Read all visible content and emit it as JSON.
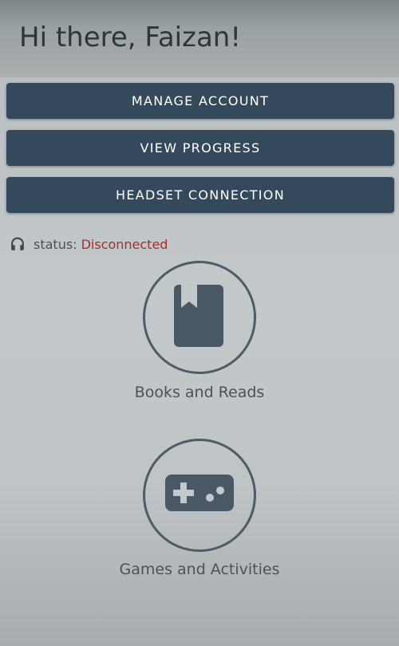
{
  "header": {
    "greeting": "Hi there, Faizan!"
  },
  "buttons": {
    "manage_account": "MANAGE ACCOUNT",
    "view_progress": "VIEW PROGRESS",
    "headset_connection": "HEADSET CONNECTION"
  },
  "status": {
    "icon": "headphones-icon",
    "label": "status:",
    "value": "Disconnected",
    "value_color": "#a3302a"
  },
  "tiles": [
    {
      "icon": "book-icon",
      "label": "Books and Reads"
    },
    {
      "icon": "gamepad-icon",
      "label": "Games and Activities"
    }
  ],
  "colors": {
    "button_bg": "#34495c",
    "button_text": "#ffffff",
    "icon_fill": "#4a5866",
    "circle_stroke": "#4f5b66"
  }
}
